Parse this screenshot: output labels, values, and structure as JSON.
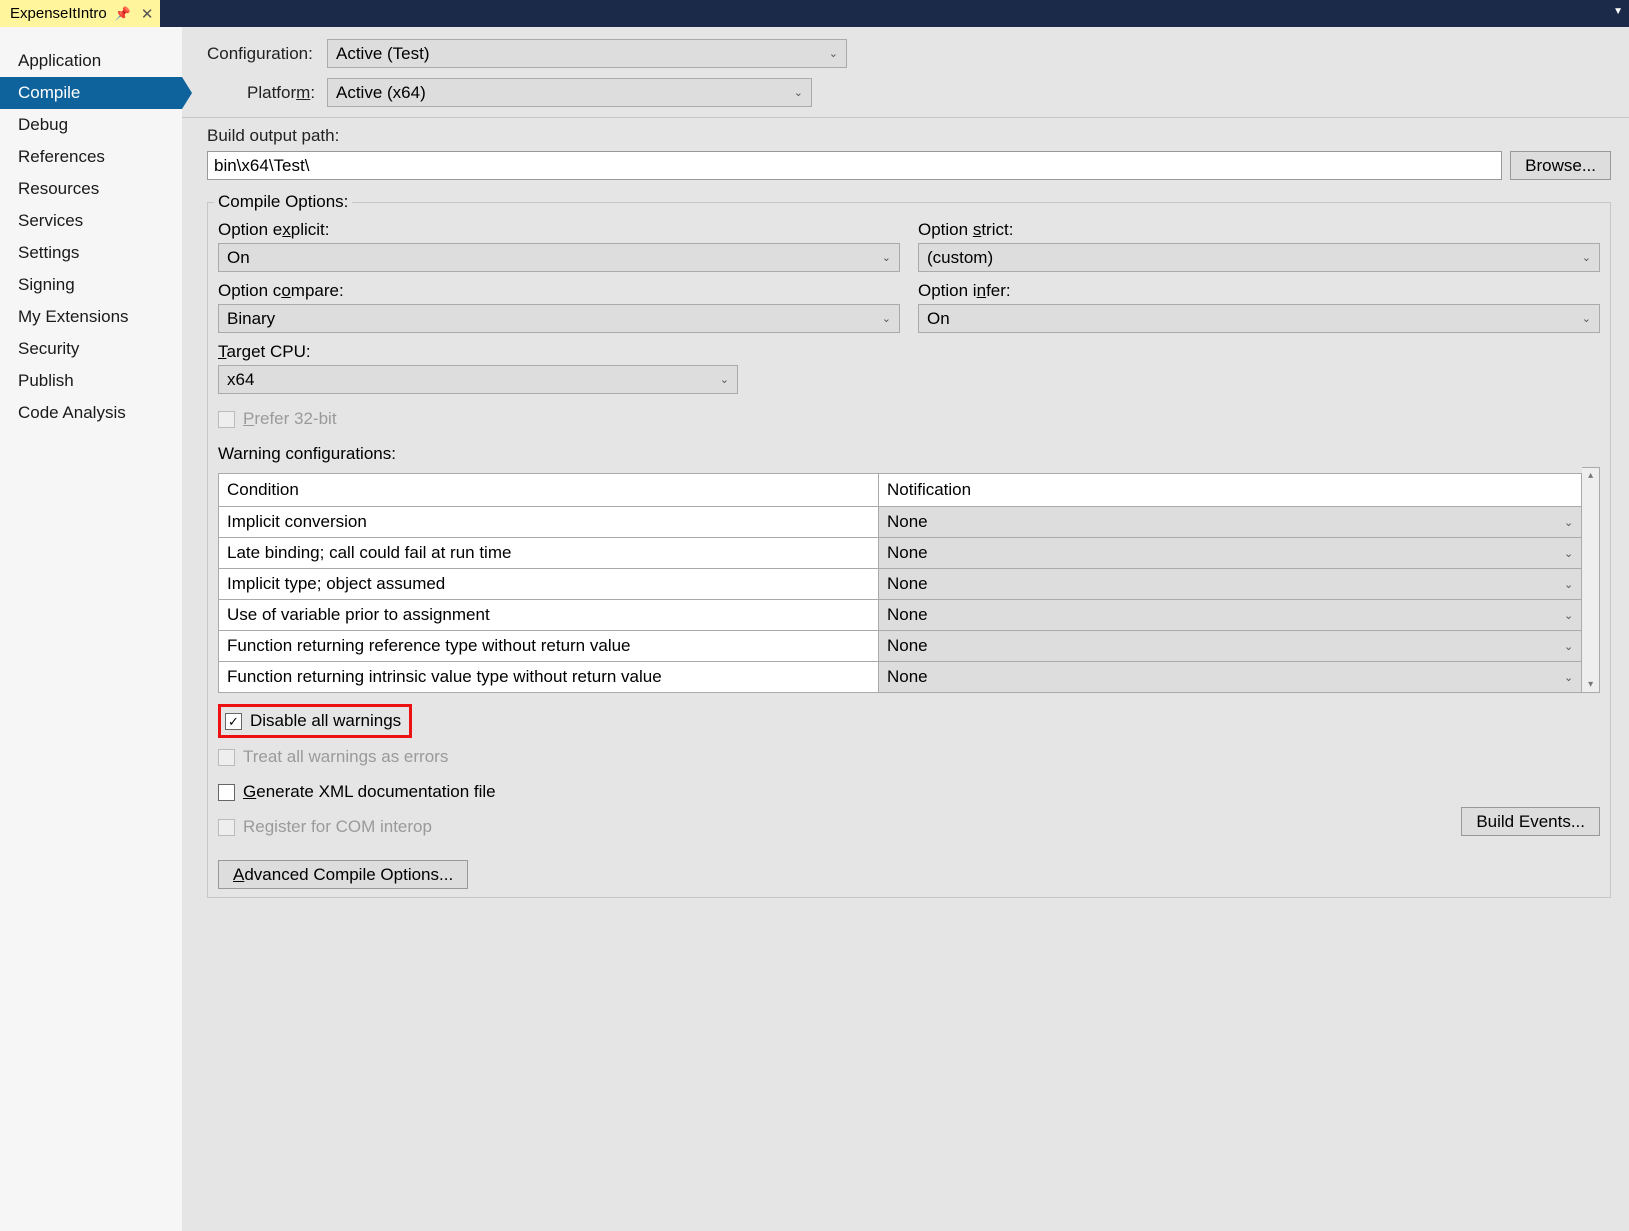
{
  "tab": {
    "title": "ExpenseItIntro"
  },
  "sidebar": {
    "items": [
      {
        "label": "Application"
      },
      {
        "label": "Compile"
      },
      {
        "label": "Debug"
      },
      {
        "label": "References"
      },
      {
        "label": "Resources"
      },
      {
        "label": "Services"
      },
      {
        "label": "Settings"
      },
      {
        "label": "Signing"
      },
      {
        "label": "My Extensions"
      },
      {
        "label": "Security"
      },
      {
        "label": "Publish"
      },
      {
        "label": "Code Analysis"
      }
    ],
    "selected": "Compile"
  },
  "config": {
    "configuration_label": "Configuration:",
    "configuration_value": "Active (Test)",
    "platform_label": "Platform:",
    "platform_value": "Active (x64)"
  },
  "buildpath": {
    "label": "Build output path:",
    "value": "bin\\x64\\Test\\",
    "browse_label": "Browse..."
  },
  "compile_options": {
    "legend": "Compile Options:",
    "explicit_label": "Option explicit:",
    "explicit_value": "On",
    "strict_label": "Option strict:",
    "strict_value": "(custom)",
    "compare_label": "Option compare:",
    "compare_value": "Binary",
    "infer_label": "Option infer:",
    "infer_value": "On",
    "target_label": "Target CPU:",
    "target_value": "x64",
    "prefer32_label": "Prefer 32-bit",
    "warning_label": "Warning configurations:",
    "table": {
      "col_condition": "Condition",
      "col_notification": "Notification",
      "rows": [
        {
          "cond": "Implicit conversion",
          "notif": "None"
        },
        {
          "cond": "Late binding; call could fail at run time",
          "notif": "None"
        },
        {
          "cond": "Implicit type; object assumed",
          "notif": "None"
        },
        {
          "cond": "Use of variable prior to assignment",
          "notif": "None"
        },
        {
          "cond": "Function returning reference type without return value",
          "notif": "None"
        },
        {
          "cond": "Function returning intrinsic value type without return value",
          "notif": "None"
        }
      ]
    },
    "disable_warnings_label": "Disable all warnings",
    "treat_errors_label": "Treat all warnings as errors",
    "gen_xml_label": "Generate XML documentation file",
    "register_com_label": "Register for COM interop",
    "build_events_label": "Build Events...",
    "advanced_label": "Advanced Compile Options..."
  }
}
